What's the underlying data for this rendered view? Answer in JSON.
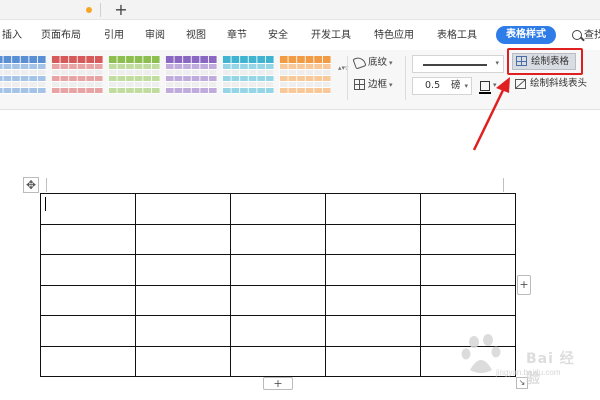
{
  "tabs": {
    "add_label": "+"
  },
  "menu": {
    "items": [
      "插入",
      "页面布局",
      "引用",
      "审阅",
      "视图",
      "章节",
      "安全",
      "开发工具",
      "特色应用",
      "表格工具",
      "表格样式",
      "查找"
    ],
    "active_index": 10
  },
  "ribbon": {
    "style_gallery": {
      "swatch_colors": [
        "#5b8fd3",
        "#d65a5a",
        "#8cbf4f",
        "#8a67c0",
        "#3fb3cf",
        "#f29b45"
      ],
      "scroll_glyphs": "▴▾▿"
    },
    "shading_label": "底纹",
    "border_label": "边框",
    "line_weight_value": "0.5",
    "line_weight_unit": "磅",
    "draw_table_label": "绘制表格",
    "draw_diagonal_header_label": "绘制斜线表头"
  },
  "document": {
    "move_handle_glyph": "✥",
    "table": {
      "rows": 6,
      "cols": 5
    },
    "add_column_glyph": "+",
    "add_row_glyph": "+",
    "resize_glyph": "↘"
  },
  "annotation": {
    "color": "#e02020"
  },
  "watermark": {
    "text": "Bai 经验",
    "url": "jingyan.baidu.com"
  },
  "colors": {
    "accent": "#2d7ce8",
    "tab_dot": "#f5a623"
  }
}
